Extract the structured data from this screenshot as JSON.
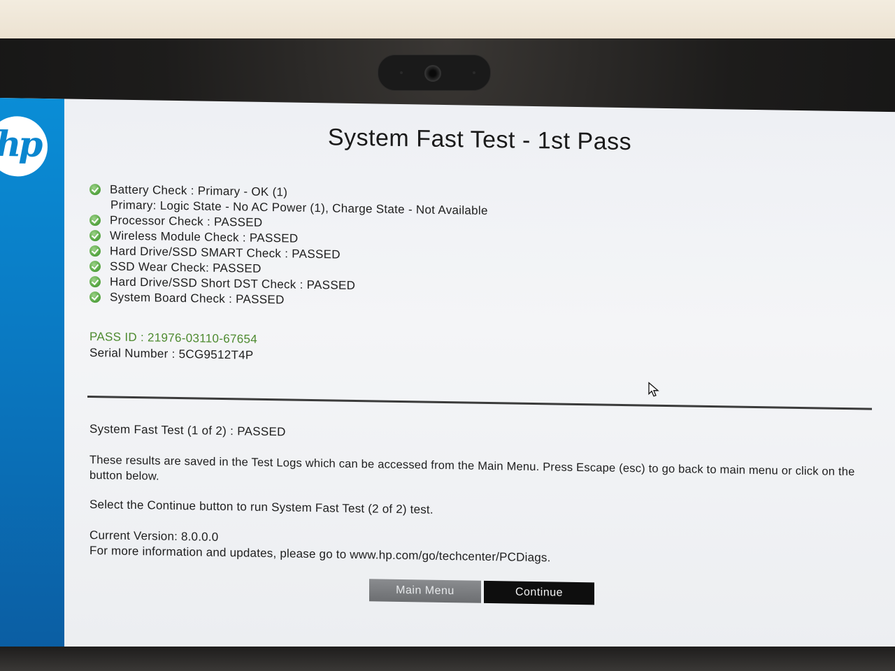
{
  "title": "System Fast Test - 1st Pass",
  "logo": {
    "text": "hp",
    "icon": "hp-logo"
  },
  "checks": [
    {
      "text": "Battery Check : Primary - OK (1)",
      "status": "ok"
    },
    {
      "text": "Primary: Logic State - No AC Power (1), Charge State - Not Available",
      "status": "detail"
    },
    {
      "text": "Processor Check : PASSED",
      "status": "ok"
    },
    {
      "text": "Wireless Module Check : PASSED",
      "status": "ok"
    },
    {
      "text": "Hard Drive/SSD SMART Check : PASSED",
      "status": "ok"
    },
    {
      "text": "SSD Wear Check: PASSED",
      "status": "ok"
    },
    {
      "text": "Hard Drive/SSD Short DST Check : PASSED",
      "status": "ok"
    },
    {
      "text": "System Board Check : PASSED",
      "status": "ok"
    }
  ],
  "pass_id": "PASS ID : 21976-03110-67654",
  "serial_number": "Serial Number : 5CG9512T4P",
  "summary": "System Fast Test (1 of 2) : PASSED",
  "saved_note": "These results are saved in the Test Logs which can be accessed from the Main Menu. Press Escape (esc) to go back to main menu or click on the button below.",
  "continue_note": "Select the Continue button to run System Fast Test (2 of 2) test.",
  "version": "Current Version: 8.0.0.0",
  "more_info": "For more information and updates, please go to www.hp.com/go/techcenter/PCDiags.",
  "buttons": {
    "main_menu": "Main Menu",
    "continue": "Continue"
  },
  "colors": {
    "sidebar": "#0a86cf",
    "pass_green": "#4d8a2f",
    "check_green": "#5aa845",
    "continue_bg": "#0e0e0e",
    "main_menu_bg": "#7a7c7f"
  }
}
